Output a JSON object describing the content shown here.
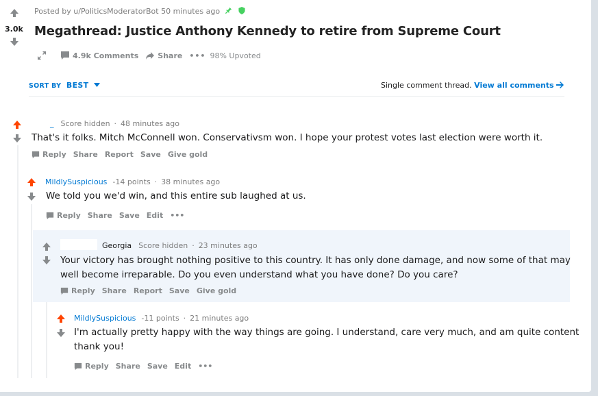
{
  "post": {
    "posted_by_prefix": "Posted by",
    "author": "u/PoliticsModeratorBot",
    "time": "50 minutes ago",
    "score": "3.0k",
    "title": "Megathread: Justice Anthony Kennedy to retire from Supreme Court",
    "comments_label": "4.9k Comments",
    "share_label": "Share",
    "upvoted": "98% Upvoted"
  },
  "sort": {
    "label": "SORT BY",
    "value": "BEST"
  },
  "thread_notice": {
    "text": "Single comment thread.",
    "link": "View all comments"
  },
  "comments": [
    {
      "user": "_",
      "score": "Score hidden",
      "time": "48 minutes ago",
      "body": "That's it folks. Mitch McConnell won. Conservativsm won. I hope your protest votes last election were worth it.",
      "actions": [
        "Reply",
        "Share",
        "Report",
        "Save",
        "Give gold"
      ]
    },
    {
      "user": "MildlySuspicious",
      "score": "-14 points",
      "time": "38 minutes ago",
      "body": "We told you we'd win, and this entire sub laughed at us.",
      "actions": [
        "Reply",
        "Share",
        "Save",
        "Edit",
        "•••"
      ]
    },
    {
      "user": "Georgia",
      "score": "Score hidden",
      "time": "23 minutes ago",
      "body_line1": "Your victory has brought nothing positive to this country. It has only done damage, and now some of that may",
      "body_line2": "well become irreparable. Do you even understand what you have done? Do you care?",
      "actions": [
        "Reply",
        "Share",
        "Report",
        "Save",
        "Give gold"
      ]
    },
    {
      "user": "MildlySuspicious",
      "score": "-11 points",
      "time": "21 minutes ago",
      "body_line1": "I'm actually pretty happy with the way things are going. I understand, care very much, and am quite content",
      "body_line2": "thank you!",
      "actions": [
        "Reply",
        "Share",
        "Save",
        "Edit",
        "•••"
      ]
    }
  ],
  "colors": {
    "upvote": "#ff4500",
    "neutral": "#878a8c",
    "link": "#0079d3",
    "highlight": "#f0f5fb"
  }
}
